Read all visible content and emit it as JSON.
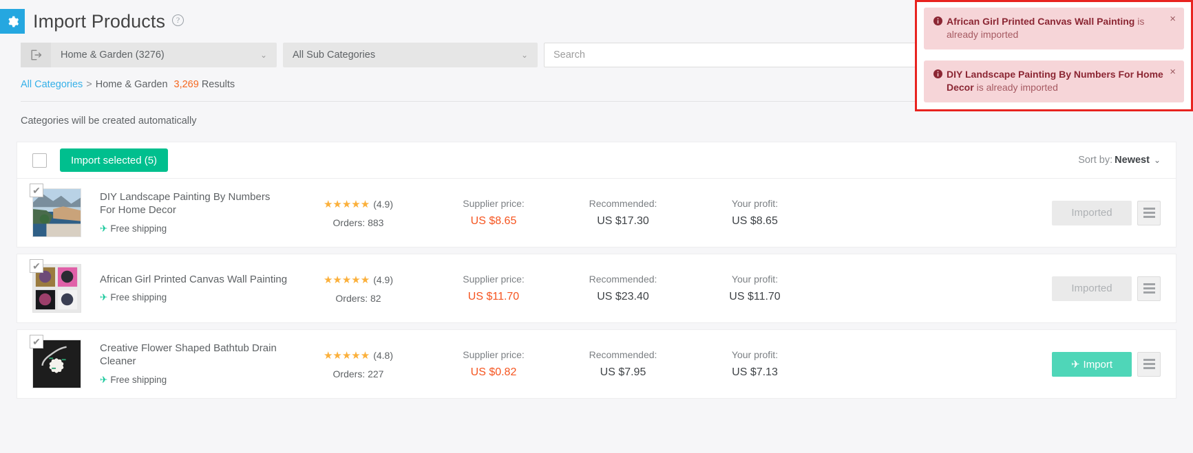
{
  "header": {
    "gear_icon": "gear-icon",
    "title": "Import Products",
    "help_icon": "?"
  },
  "filters": {
    "category_icon": "export-icon",
    "category_value": "Home & Garden (3276)",
    "subcategory_value": "All Sub Categories",
    "search_placeholder": "Search",
    "search_value": "",
    "caret": "⌄"
  },
  "breadcrumb": {
    "root": "All Categories",
    "separator": ">",
    "current": "Home & Garden",
    "count": "3,269",
    "results_label": "Results"
  },
  "notice": "Categories will be created automatically",
  "toolbar": {
    "select_all_checked": false,
    "import_selected_label": "Import selected (5)",
    "sort_prefix": "Sort by:",
    "sort_value": "Newest",
    "sort_caret": "⌄"
  },
  "toasts": [
    {
      "icon": "info-circle-icon",
      "strong": "African Girl Printed Canvas Wall Painting",
      "rest": " is already imported",
      "close": "×"
    },
    {
      "icon": "info-circle-icon",
      "strong": "DIY Landscape Painting By Numbers For Home Decor",
      "rest": " is already imported",
      "close": "×"
    }
  ],
  "columns": {
    "supplier_price": "Supplier price:",
    "recommended": "Recommended:",
    "your_profit": "Your profit:"
  },
  "products": [
    {
      "checked": true,
      "name": "DIY Landscape Painting By Numbers For Home Decor",
      "shipping": "Free shipping",
      "stars": "★★★★★",
      "rating": "(4.9)",
      "orders": "Orders: 883",
      "supplier_price": "US $8.65",
      "recommended": "US $17.30",
      "your_profit": "US $8.65",
      "action_label": "Imported",
      "action_state": "imported",
      "menu_icon": "hamburger-icon"
    },
    {
      "checked": true,
      "name": "African Girl Printed Canvas Wall Painting",
      "shipping": "Free shipping",
      "stars": "★★★★★",
      "rating": "(4.9)",
      "orders": "Orders: 82",
      "supplier_price": "US $11.70",
      "recommended": "US $23.40",
      "your_profit": "US $11.70",
      "action_label": "Imported",
      "action_state": "imported",
      "menu_icon": "hamburger-icon"
    },
    {
      "checked": true,
      "name": "Creative Flower Shaped Bathtub Drain Cleaner",
      "shipping": "Free shipping",
      "stars": "★★★★★",
      "rating": "(4.8)",
      "orders": "Orders: 227",
      "supplier_price": "US $0.82",
      "recommended": "US $7.95",
      "your_profit": "US $7.13",
      "action_label": "Import",
      "action_state": "import",
      "menu_icon": "hamburger-icon"
    }
  ],
  "colors": {
    "brand_blue": "#25a7e0",
    "green": "#00bf8e",
    "green_light": "#4fd6b8",
    "orange": "#f5541f",
    "star": "#fbb03b",
    "toast_bg": "#f6d5d8",
    "toast_border": "#e8231f"
  }
}
